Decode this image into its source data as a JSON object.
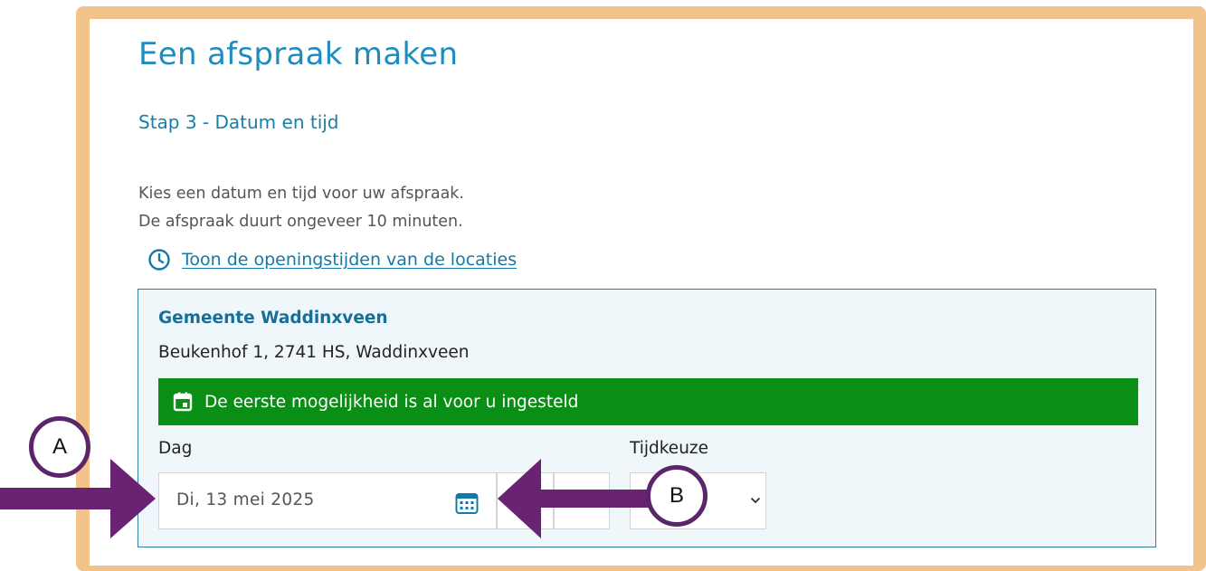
{
  "page": {
    "title": "Een afspraak maken",
    "step": "Stap 3 - Datum en tijd",
    "intro_line1": "Kies een datum en tijd voor uw afspraak.",
    "intro_line2": "De afspraak duurt ongeveer 10 minuten.",
    "hours_link": "Toon de openingstijden van de locaties"
  },
  "location": {
    "name": "Gemeente Waddinxveen",
    "address": "Beukenhof 1, 2741 HS, Waddinxveen",
    "notice": "De eerste mogelijkheid is al voor u ingesteld"
  },
  "form": {
    "day_label": "Dag",
    "day_value": "Di, 13 mei 2025",
    "time_label": "Tijdkeuze",
    "time_value": ""
  },
  "annotations": {
    "callout_a": "A",
    "callout_b": "B"
  },
  "colors": {
    "frame": "#f2c48c",
    "title_blue": "#1f8cc0",
    "notice_green": "#098f15",
    "annotation_purple": "#6a2373"
  },
  "icons": {
    "hours_link": "clock-icon",
    "notice": "calendar-icon",
    "date_picker": "calendar-grid-icon",
    "time_select": "chevron-down-icon"
  }
}
